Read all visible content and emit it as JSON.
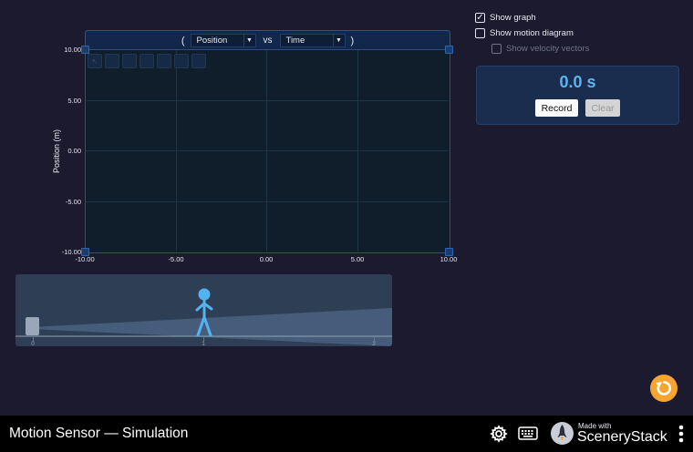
{
  "graph": {
    "open_paren": "(",
    "close_paren": ")",
    "y_quantity": "Position",
    "vs_label": "vs",
    "x_quantity": "Time",
    "y_axis_label": "Position (m)",
    "y_ticks": [
      "10.00",
      "5.00",
      "0.00",
      "-5.00",
      "-10.00"
    ],
    "x_ticks": [
      "-10.00",
      "-5.00",
      "0.00",
      "5.00",
      "10.00"
    ],
    "x_range": [
      -10,
      10
    ],
    "y_range": [
      -10,
      10
    ]
  },
  "scene": {
    "scale_labels": [
      "0",
      "1",
      "2"
    ]
  },
  "controls": {
    "show_graph": {
      "label": "Show graph",
      "checked": true
    },
    "show_motion_diagram": {
      "label": "Show motion diagram",
      "checked": false
    },
    "show_velocity_vectors": {
      "label": "Show velocity vectors",
      "checked": false,
      "disabled": true
    }
  },
  "timer": {
    "readout": "0.0 s",
    "record_label": "Record",
    "clear_label": "Clear"
  },
  "nav": {
    "title": "Motion Sensor — Simulation",
    "made_with": "Made with",
    "brand": "SceneryStack"
  },
  "colors": {
    "background": "#1c1a2e",
    "accent_blue": "#5fb3f0",
    "reset_orange": "#f7a531"
  }
}
